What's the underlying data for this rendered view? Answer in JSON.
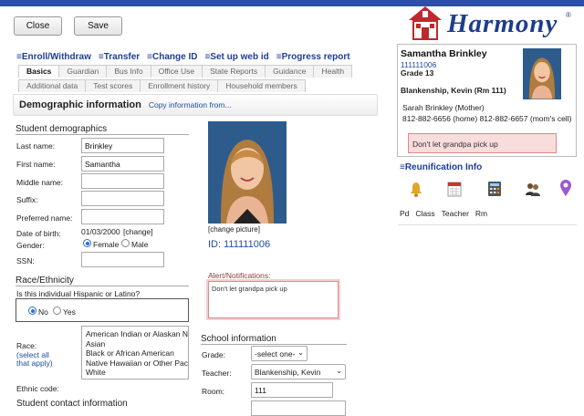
{
  "toolbar": {
    "close_label": "Close",
    "save_label": "Save"
  },
  "logo": {
    "text": "Harmony",
    "reg": "®"
  },
  "actions": [
    "≡Enroll/Withdraw",
    "≡Transfer",
    "≡Change ID",
    "≡Set up web id",
    "≡Progress report"
  ],
  "tabs_row1": [
    "Basics",
    "Guardian",
    "Bus Info",
    "Office Use",
    "State Reports",
    "Guidance",
    "Health"
  ],
  "tabs_row2": [
    "Additional data",
    "Test scores",
    "Enrollment history",
    "Household members"
  ],
  "section": {
    "title": "Demographic information",
    "link": "Copy information from..."
  },
  "demographics": {
    "header": "Student demographics",
    "last_name_label": "Last name:",
    "last_name": "Brinkley",
    "first_name_label": "First name:",
    "first_name": "Samantha",
    "middle_name_label": "Middle name:",
    "middle_name": "",
    "suffix_label": "Suffix:",
    "suffix": "",
    "preferred_label": "Preferred name:",
    "preferred": "",
    "dob_label": "Date of birth:",
    "dob": "01/03/2000",
    "dob_change": "[change]",
    "gender_label": "Gender:",
    "female": "Female",
    "male": "Male",
    "ssn_label": "SSN:",
    "ssn": ""
  },
  "photo": {
    "change_label": "[change picture]",
    "id_label": "ID: 111111006"
  },
  "alerts": {
    "label": "Alert/Notifications:",
    "text": "Don't let grandpa pick up"
  },
  "race": {
    "header": "Race/Ethnicity",
    "hispanic_q": "Is this individual Hispanic or Latino?",
    "no": "No",
    "yes": "Yes",
    "race_label": "Race:",
    "select_all": "(select all",
    "that_apply": "that apply)",
    "options": [
      "American Indian or Alaskan Nat",
      "Asian",
      "Black or African American",
      "Native Hawaiian or Other Pacific",
      "White"
    ],
    "ethnic_label": "Ethnic code:",
    "cut_label": "Student contact information"
  },
  "school": {
    "header": "School information",
    "grade_label": "Grade:",
    "grade": "-select one-",
    "teacher_label": "Teacher:",
    "teacher": "Blankenship, Kevin",
    "room_label": "Room:",
    "room": "111"
  },
  "card": {
    "name": "Samantha Brinkley",
    "id": "111111006",
    "grade": "Grade 13",
    "teacher": "Blankenship, Kevin (Rm 111)",
    "guardian": "Sarah Brinkley (Mother)",
    "phones": "812-882-6656 (home) 812-882-6657 (mom's cell)",
    "alert": "Don't let grandpa pick up"
  },
  "reunification": {
    "title": "≡Reunification Info",
    "cols": [
      "Pd",
      "Class",
      "Teacher",
      "Rm"
    ]
  },
  "colors": {
    "brand": "#1f3d8f",
    "alert_bg": "#f9dcdc",
    "link": "#1f4ea0"
  }
}
